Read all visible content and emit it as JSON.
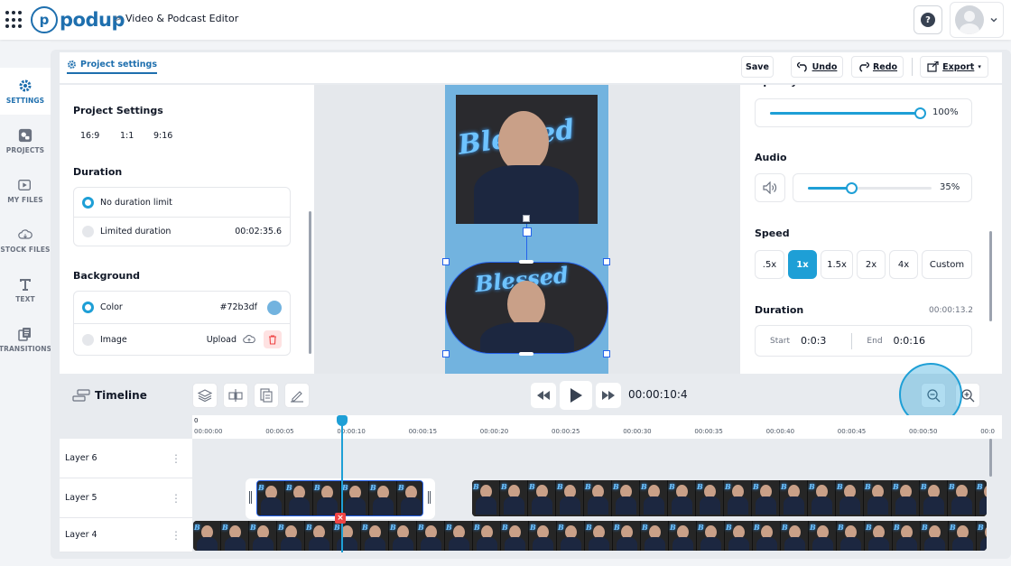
{
  "header": {
    "app_name": "podup",
    "breadcrumb_sep": ">",
    "breadcrumb": "Video & Podcast Editor",
    "help_icon": "question-icon",
    "avatar_icon": "avatar-icon"
  },
  "sidebar": {
    "items": [
      {
        "label": "SETTINGS",
        "icon": "gear-icon",
        "active": true
      },
      {
        "label": "PROJECTS",
        "icon": "projects-icon",
        "active": false
      },
      {
        "label": "MY FILES",
        "icon": "play-file-icon",
        "active": false
      },
      {
        "label": "STOCK FILES",
        "icon": "cloud-icon",
        "active": false
      },
      {
        "label": "TEXT",
        "icon": "text-icon",
        "active": false
      },
      {
        "label": "TRANSITIONS",
        "icon": "transitions-icon",
        "active": false
      }
    ]
  },
  "toolbar": {
    "project_tab": "Project settings",
    "save": "Save",
    "undo": "Undo",
    "redo": "Redo",
    "export": "Export"
  },
  "project_settings": {
    "title": "Project Settings",
    "ratios": [
      "16:9",
      "1:1",
      "9:16"
    ],
    "duration_title": "Duration",
    "no_limit": "No duration limit",
    "limited": "Limited duration",
    "limited_value": "00:02:35.6",
    "background_title": "Background",
    "color_label": "Color",
    "color_value": "#72b3df",
    "image_label": "Image",
    "upload_label": "Upload"
  },
  "preview": {
    "neon_text": "Blessed",
    "bg_color": "#72b3df"
  },
  "properties": {
    "opacity_label": "Opacity",
    "opacity_value": "100%",
    "opacity_level": 1.0,
    "audio_label": "Audio",
    "audio_value": "35%",
    "audio_level": 0.35,
    "speed_label": "Speed",
    "speed_options": [
      ".5x",
      "1x",
      "1.5x",
      "2x",
      "4x",
      "Custom"
    ],
    "speed_selected": "1x",
    "duration_label": "Duration",
    "duration_value": "00:00:13.2",
    "start_label": "Start",
    "start_value": "0:0:3",
    "end_label": "End",
    "end_value": "0:0:16"
  },
  "timeline": {
    "title": "Timeline",
    "current_time": "00:00:10:4",
    "ruler_zero": "0",
    "ticks": [
      "00:00:00",
      "00:00:05",
      "00:00:10",
      "00:00:15",
      "00:00:20",
      "00:00:25",
      "00:00:30",
      "00:00:35",
      "00:00:40",
      "00:00:45",
      "00:00:50",
      "00:0"
    ],
    "layers": [
      "Layer 6",
      "Layer 5",
      "Layer 4"
    ],
    "playhead_seconds": 10.4
  },
  "colors": {
    "accent": "#1e9fd6",
    "brand": "#1e6fae",
    "delete": "#ef4444"
  }
}
